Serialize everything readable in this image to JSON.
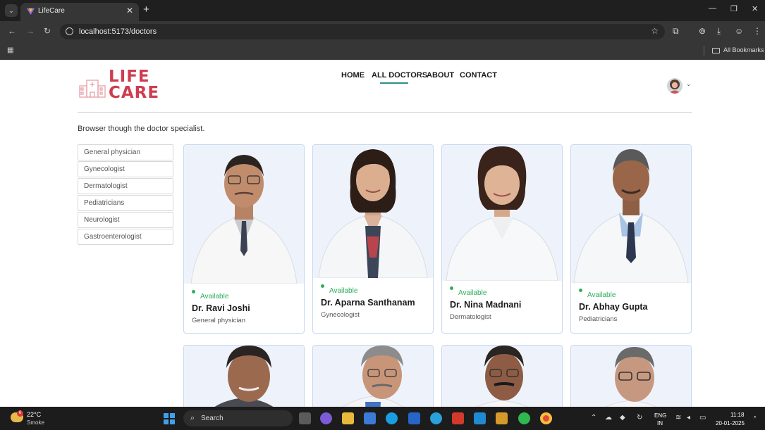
{
  "browser": {
    "tab_title": "LifeCare",
    "url": "localhost:5173/doctors",
    "bookmarks_label": "All Bookmarks",
    "accent_color": "#1f1f1f"
  },
  "site": {
    "logo_line1": "LIFE",
    "logo_line2": "CARE",
    "brand_color": "#cf3d50",
    "nav": {
      "home": "HOME",
      "all_doctors": "ALL DOCTORS",
      "about": "ABOUT",
      "contact": "CONTACT",
      "active": "ALL DOCTORS",
      "active_color": "#2d8f8a"
    }
  },
  "content": {
    "intro": "Browser though the doctor specialist.",
    "specialities": [
      "General physician",
      "Gynecologist",
      "Dermatologist",
      "Pediatricians",
      "Neurologist",
      "Gastroenterologist"
    ],
    "doctors": [
      {
        "status": "Available",
        "name": "Dr. Ravi Joshi",
        "speciality": "General physician"
      },
      {
        "status": "Available",
        "name": "Dr. Aparna Santhanam",
        "speciality": "Gynecologist"
      },
      {
        "status": "Available",
        "name": "Dr. Nina Madnani",
        "speciality": "Dermatologist"
      },
      {
        "status": "Available",
        "name": "Dr. Abhay Gupta",
        "speciality": "Pediatricians"
      }
    ],
    "available_color": "#2fae5a"
  },
  "taskbar": {
    "temperature": "22°C",
    "condition": "Smoke",
    "search_label": "Search",
    "weather_badge": "6",
    "lang_top": "ENG",
    "lang_bottom": "IN",
    "time": "11:18",
    "date": "20-01-2025"
  }
}
